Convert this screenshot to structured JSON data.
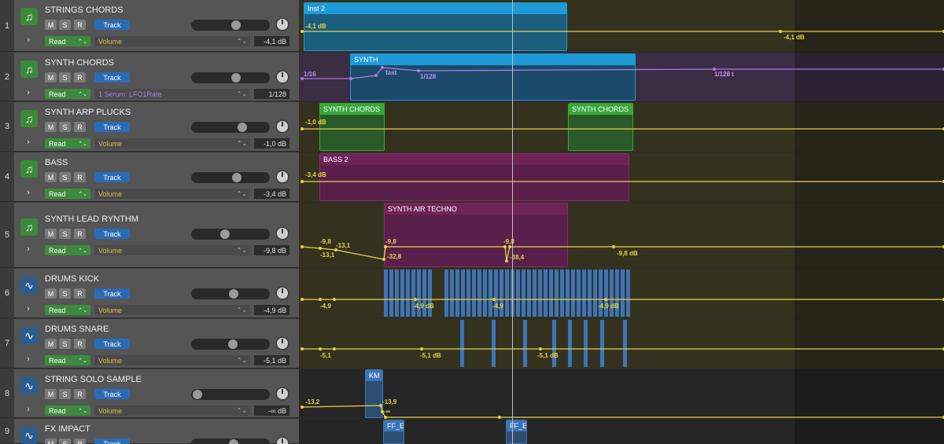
{
  "buttons": {
    "mute": "M",
    "solo": "S",
    "record": "R",
    "track": "Track",
    "read": "Read",
    "expand": "›",
    "up_down": "⌃⌄"
  },
  "tracks": [
    {
      "num": "1",
      "name": "STRINGS CHORDS",
      "type": "instrument",
      "param": "Volume",
      "value": "-4,1 dB",
      "vol_level": 0.58
    },
    {
      "num": "2",
      "name": "SYNTH CHORDS",
      "type": "instrument",
      "param": "1 Serum: LFO1Rate",
      "value": "1/128",
      "vol_level": 0.58
    },
    {
      "num": "3",
      "name": "SYNTH ARP PLUCKS",
      "type": "instrument",
      "param": "Volume",
      "value": "-1,0 dB",
      "vol_level": 0.68
    },
    {
      "num": "4",
      "name": "BASS",
      "type": "instrument",
      "param": "Volume",
      "value": "-3,4 dB",
      "vol_level": 0.6
    },
    {
      "num": "5",
      "name": "SYNTH LEAD  RYNTHM",
      "type": "instrument",
      "param": "Volume",
      "value": "-9,8 dB",
      "vol_level": 0.42
    },
    {
      "num": "6",
      "name": "DRUMS KICK",
      "type": "audio",
      "param": "Volume",
      "value": "-4,9 dB",
      "vol_level": 0.55
    },
    {
      "num": "7",
      "name": "DRUMS SNARE",
      "type": "audio",
      "param": "Volume",
      "value": "-5,1 dB",
      "vol_level": 0.54
    },
    {
      "num": "8",
      "name": "STRING SOLO SAMPLE",
      "type": "audio",
      "param": "Volume",
      "value": "-∞ dB",
      "vol_level": 0.0
    },
    {
      "num": "9",
      "name": "FX IMPACT",
      "type": "audio",
      "param": "Volume",
      "value": "",
      "vol_level": 0.55
    }
  ],
  "regions": {
    "inst2": "Inst 2",
    "synth": "SYNTH",
    "synth_chords_a": "SYNTH CHORDS",
    "synth_chords_b": "SYNTH CHORDS",
    "bass2": "BASS 2",
    "synth_air_techno": "SYNTH AIR TECHNO",
    "km": "KM",
    "ffe_a": "FF_E",
    "ffe_b": "FF_E"
  },
  "automation_labels": {
    "t1_a": "-4,1 dB",
    "t1_b": "-4,1 dB",
    "t2_a": "1/16",
    "t2_b": "fast",
    "t2_c": "1/128",
    "t2_d": "1/128 t",
    "t3_a": "-1,0 dB",
    "t4_a": "-3,4 dB",
    "t5_a": "-9,8",
    "t5_b": "-13,1",
    "t5_c": "-13,1",
    "t5_d": "-9,8",
    "t5_e": "-32,8",
    "t5_f": "-9,8",
    "t5_g": "-38,4",
    "t5_h": "-9,8 dB",
    "t6_a": "-4,9",
    "t6_b": "-4,9 dB",
    "t6_c": "-4,9",
    "t6_d": "-4,9 dB",
    "t7_a": "-5,1",
    "t7_b": "-5,1 dB",
    "t7_c": "-5,1 dB",
    "t8_a": "-13,2",
    "t8_b": "-13,9",
    "t8_c": "-∞"
  },
  "colors": {
    "automation": "#e5d347",
    "automation_alt": "#b07ae8",
    "read": "#3d8a3d",
    "track_button": "#2a6bb5",
    "region_blue": "#1e9ad6",
    "region_green": "#39a63c",
    "region_magenta": "#8a2a6a",
    "region_steel": "#3d74b8"
  },
  "icons": {
    "instrument": "music-note-icon",
    "audio": "waveform-icon"
  }
}
